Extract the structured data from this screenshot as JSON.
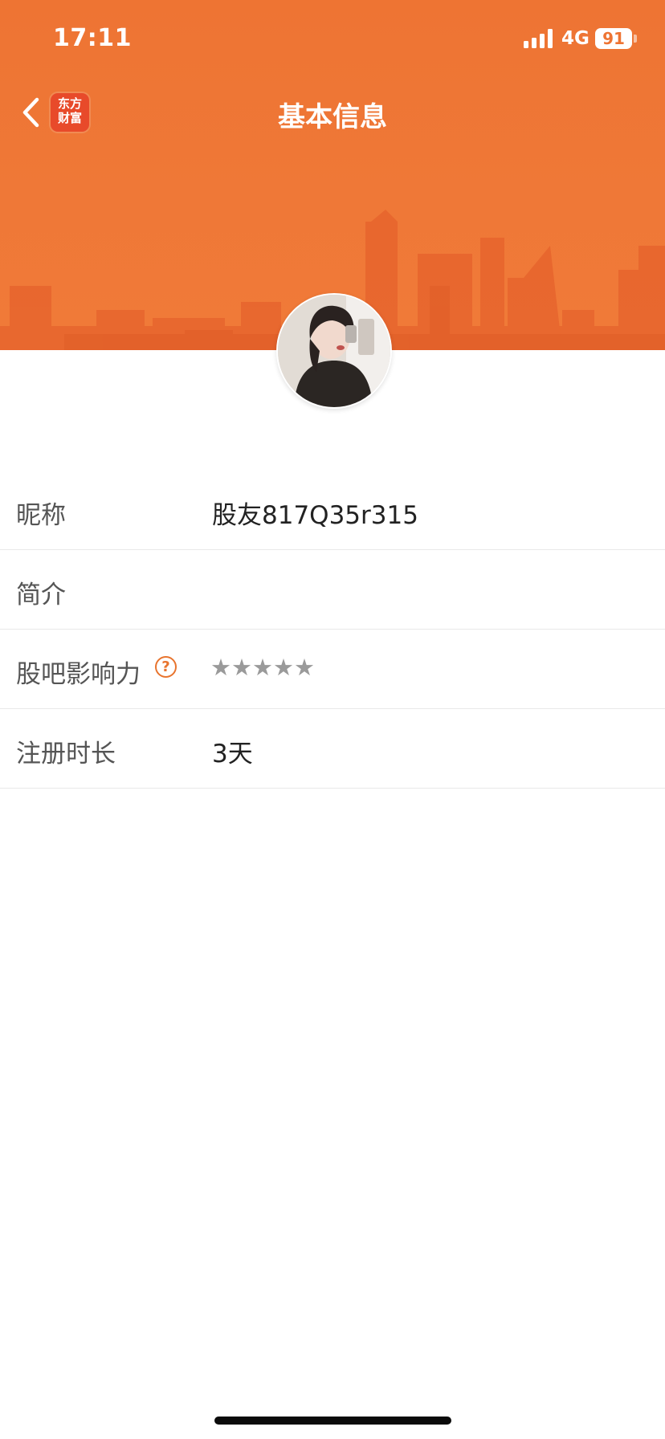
{
  "status_bar": {
    "time": "17:11",
    "network": "4G",
    "battery": "91",
    "signal_icon": "cellular-signal-icon"
  },
  "nav": {
    "title": "基本信息",
    "back_icon": "chevron-left-icon",
    "logo_line1": "东方",
    "logo_line2": "财富"
  },
  "header": {
    "background_color": "#ee7433",
    "background_image": "city-skyline"
  },
  "profile": {
    "avatar_icon": "user-avatar-photo"
  },
  "info": {
    "rows": [
      {
        "label": "昵称",
        "value": "股友817Q35r315"
      },
      {
        "label": "简介",
        "value": ""
      },
      {
        "label": "股吧影响力",
        "stars": "★★★★★",
        "rating": 0,
        "max_rating": 5,
        "help_icon": "question-circle-icon",
        "help_glyph": "?"
      },
      {
        "label": "注册时长",
        "value": "3天"
      }
    ]
  },
  "colors": {
    "accent": "#ee7433",
    "help_icon": "#e8742e",
    "star_inactive": "#9a9a9a"
  }
}
